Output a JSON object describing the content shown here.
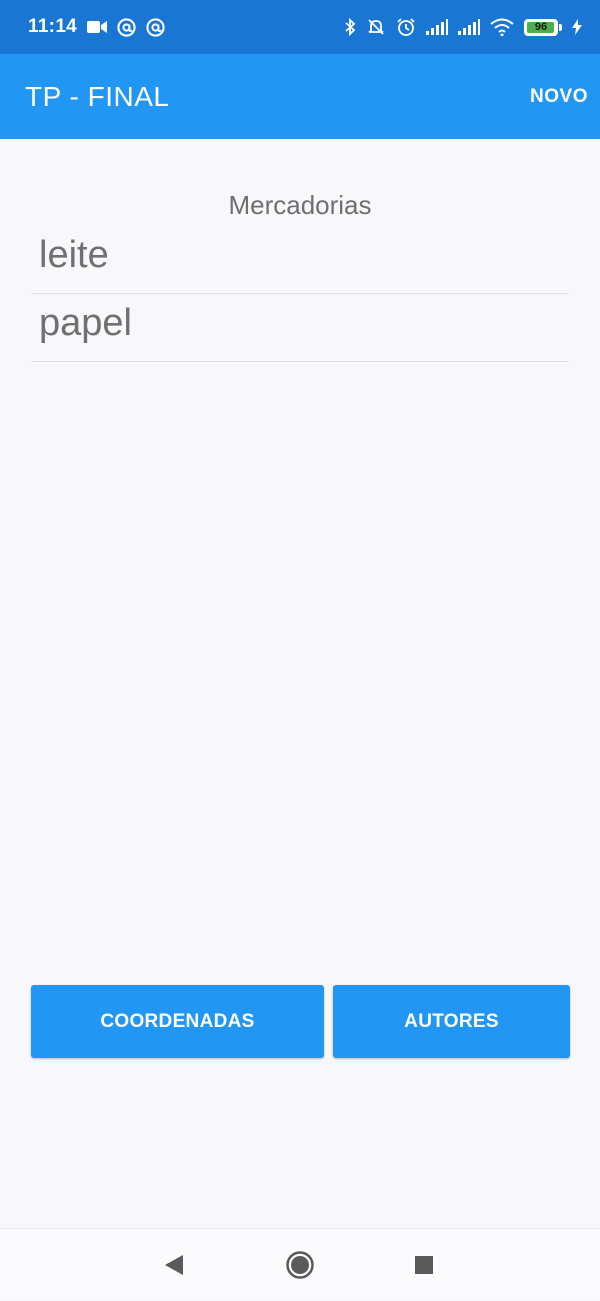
{
  "status_bar": {
    "time": "11:14",
    "battery_level": 96,
    "battery_label": "96",
    "left_icons": [
      "video-camera-icon",
      "at-sign-icon",
      "at-sign-icon"
    ],
    "right_icons": [
      "bluetooth-icon",
      "silent-bell-icon",
      "alarm-clock-icon",
      "cell-signal-icon",
      "cell-signal-icon",
      "wifi-icon",
      "battery-icon",
      "charging-bolt-icon"
    ]
  },
  "app_bar": {
    "title": "TP - FINAL",
    "action_label": "NOVO"
  },
  "main": {
    "section_title": "Mercadorias",
    "items": [
      {
        "label": "leite"
      },
      {
        "label": "papel"
      }
    ]
  },
  "bottom_buttons": {
    "coordenadas_label": "COORDENADAS",
    "autores_label": "AUTORES"
  },
  "nav_bar": {
    "icons": [
      "back-triangle-icon",
      "home-circle-icon",
      "recents-square-icon"
    ]
  },
  "colors": {
    "status_bar": "#1976d2",
    "app_bar": "#2196f3",
    "button": "#2196f3",
    "background": "#f8f7f9",
    "text_muted": "#707070"
  }
}
